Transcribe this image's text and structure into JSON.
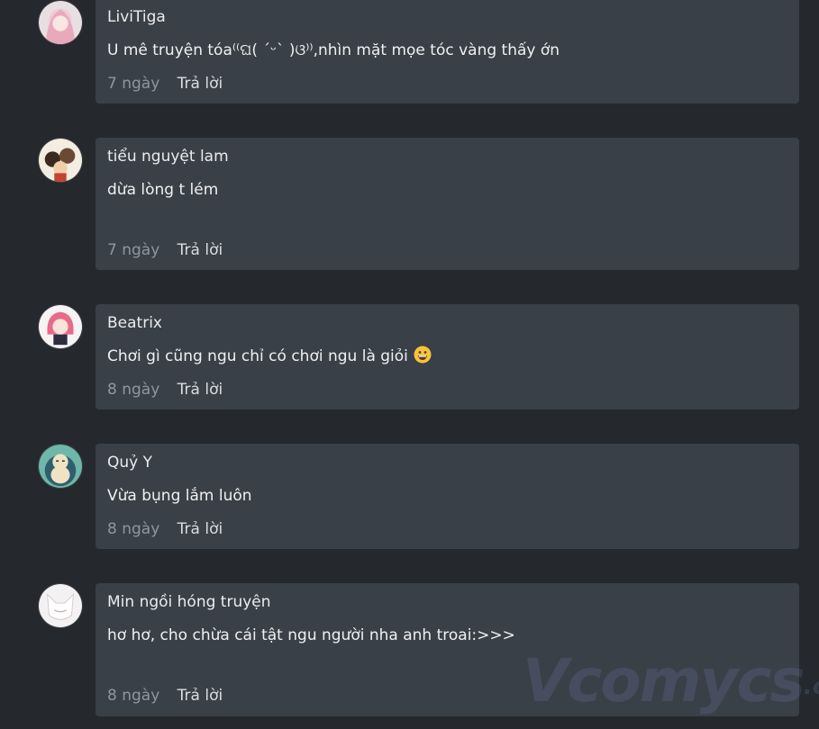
{
  "reply_label": "Trả lời",
  "comments": [
    {
      "name": "LiviTiga",
      "text": "U mê truyện tóa⁽⁽ଘ( ˊᵕˋ )ଓ⁾⁾,nhìn mặt mọe tóc vàng thấy ớn",
      "time": "7 ngày",
      "avatar_icon": "pink-hair-girl-avatar"
    },
    {
      "name": "tiểu nguyệt lam",
      "text": "dừa lòng t lém",
      "time": "7 ngày",
      "avatar_icon": "cartoon-group-avatar"
    },
    {
      "name": "Beatrix",
      "text": "Chơi gì cũng ngu chỉ có chơi ngu là giỏi",
      "time": "8 ngày",
      "avatar_icon": "pink-hair-chibi-avatar",
      "emoji": "grinning-face-emoji"
    },
    {
      "name": "Quỷ Y",
      "text": "Vừa bụng lắm luôn",
      "time": "8 ngày",
      "avatar_icon": "snorlax-avatar"
    },
    {
      "name": "Min ngồi hóng truyện",
      "text": "hơ hơ, cho chừa cái tật ngu người nha anh troai:>>>",
      "time": "8 ngày",
      "avatar_icon": "white-fox-avatar"
    }
  ],
  "watermark": {
    "main": "Vcomycs",
    "suffix": ".com"
  },
  "colors": {
    "background": "#25282c",
    "card": "#3a4047",
    "text": "#eef1f3",
    "muted": "#8e969e"
  }
}
